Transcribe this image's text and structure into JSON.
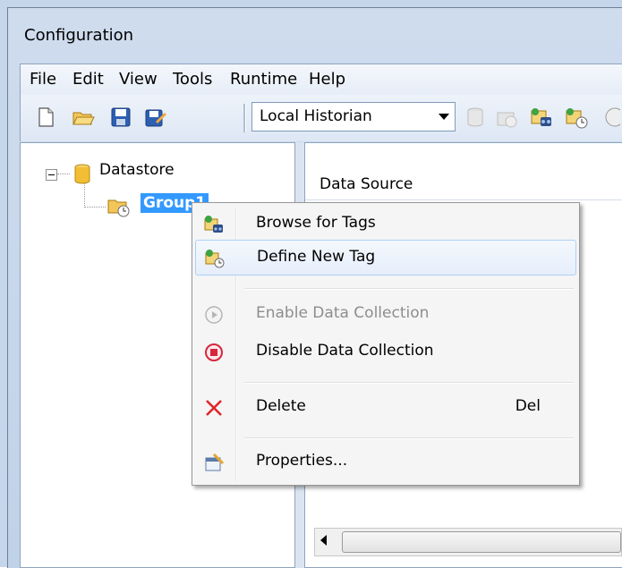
{
  "window": {
    "title": "Configuration"
  },
  "menubar": {
    "items": [
      "File",
      "Edit",
      "View",
      "Tools",
      "Runtime",
      "Help"
    ]
  },
  "toolbar": {
    "historian_select": "Local Historian"
  },
  "tree": {
    "root": "Datastore",
    "child": "Group1"
  },
  "list": {
    "column_header": "Data Source"
  },
  "context_menu": {
    "items": [
      {
        "label": "Browse for Tags",
        "icon": "browse-tags-icon",
        "enabled": true
      },
      {
        "label": "Define New Tag",
        "icon": "define-tag-icon",
        "enabled": true
      },
      {
        "label": "Enable Data Collection",
        "icon": "play-circle-icon",
        "enabled": false
      },
      {
        "label": "Disable Data Collection",
        "icon": "stop-circle-icon",
        "enabled": true
      },
      {
        "label": "Delete",
        "icon": "delete-x-icon",
        "enabled": true,
        "shortcut": "Del"
      },
      {
        "label": "Properties...",
        "icon": "properties-icon",
        "enabled": true
      }
    ]
  },
  "colors": {
    "selection": "#3399ff",
    "delete_red": "#e0262b",
    "stop_red": "#d7263d"
  }
}
